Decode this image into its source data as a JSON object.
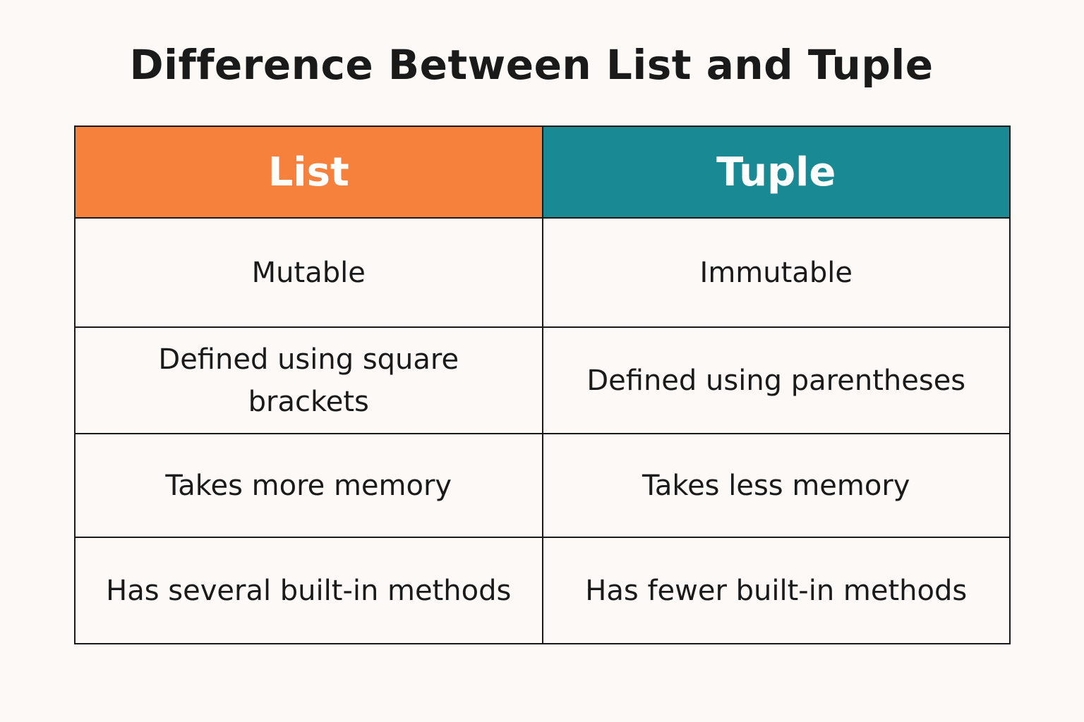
{
  "title": "Difference Between List and Tuple",
  "colors": {
    "list_header": "#f5813d",
    "tuple_header": "#198a93",
    "background": "#fcf9f6",
    "border": "#1a1a1a"
  },
  "table": {
    "headers": [
      "List",
      "Tuple"
    ],
    "rows": [
      [
        "Mutable",
        "Immutable"
      ],
      [
        "Defined using square brackets",
        "Defined using parentheses"
      ],
      [
        "Takes more memory",
        "Takes less memory"
      ],
      [
        "Has several built-in methods",
        "Has fewer built-in methods"
      ]
    ]
  }
}
